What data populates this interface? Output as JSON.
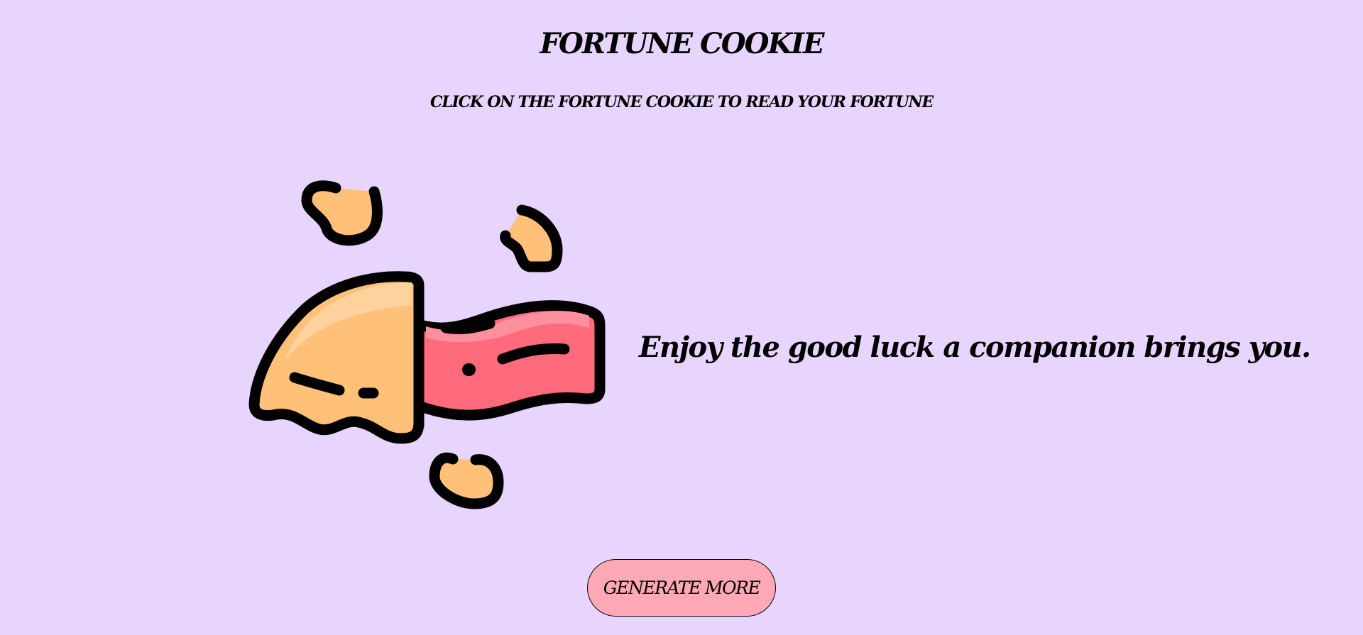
{
  "header": {
    "title": "FORTUNE COOKIE",
    "subtitle": "CLICK ON THE FORTUNE COOKIE TO READ YOUR FORTUNE"
  },
  "main": {
    "cookie_icon": "fortune-cookie-icon",
    "fortune_text": "Enjoy the good luck a companion brings you."
  },
  "actions": {
    "generate_label": "GENERATE MORE"
  },
  "colors": {
    "background": "#e8d5fe",
    "cookie": "#ffc078",
    "cookie_highlight": "#ffd3a1",
    "paper": "#ff6b7d",
    "paper_highlight": "#ff8f9c",
    "button": "#ffa8b6",
    "outline": "#000000"
  }
}
